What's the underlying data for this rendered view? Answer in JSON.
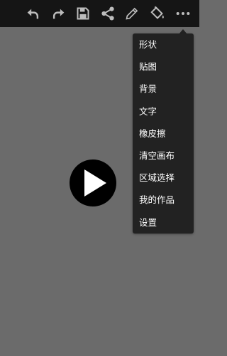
{
  "toolbar": {
    "icons": [
      "undo-icon",
      "redo-icon",
      "save-icon",
      "share-icon",
      "pencil-icon",
      "paint-bucket-icon",
      "more-icon"
    ]
  },
  "colors": {
    "toolbar_bg": "#151515",
    "canvas_bg": "#6b6b6b",
    "menu_bg": "#222222",
    "icon": "#bdbdbd"
  },
  "menu": {
    "items": [
      "形状",
      "贴图",
      "背景",
      "文字",
      "橡皮擦",
      "清空画布",
      "区域选择",
      "我的作品",
      "设置"
    ]
  },
  "video_overlay": {
    "icon": "play-icon"
  }
}
